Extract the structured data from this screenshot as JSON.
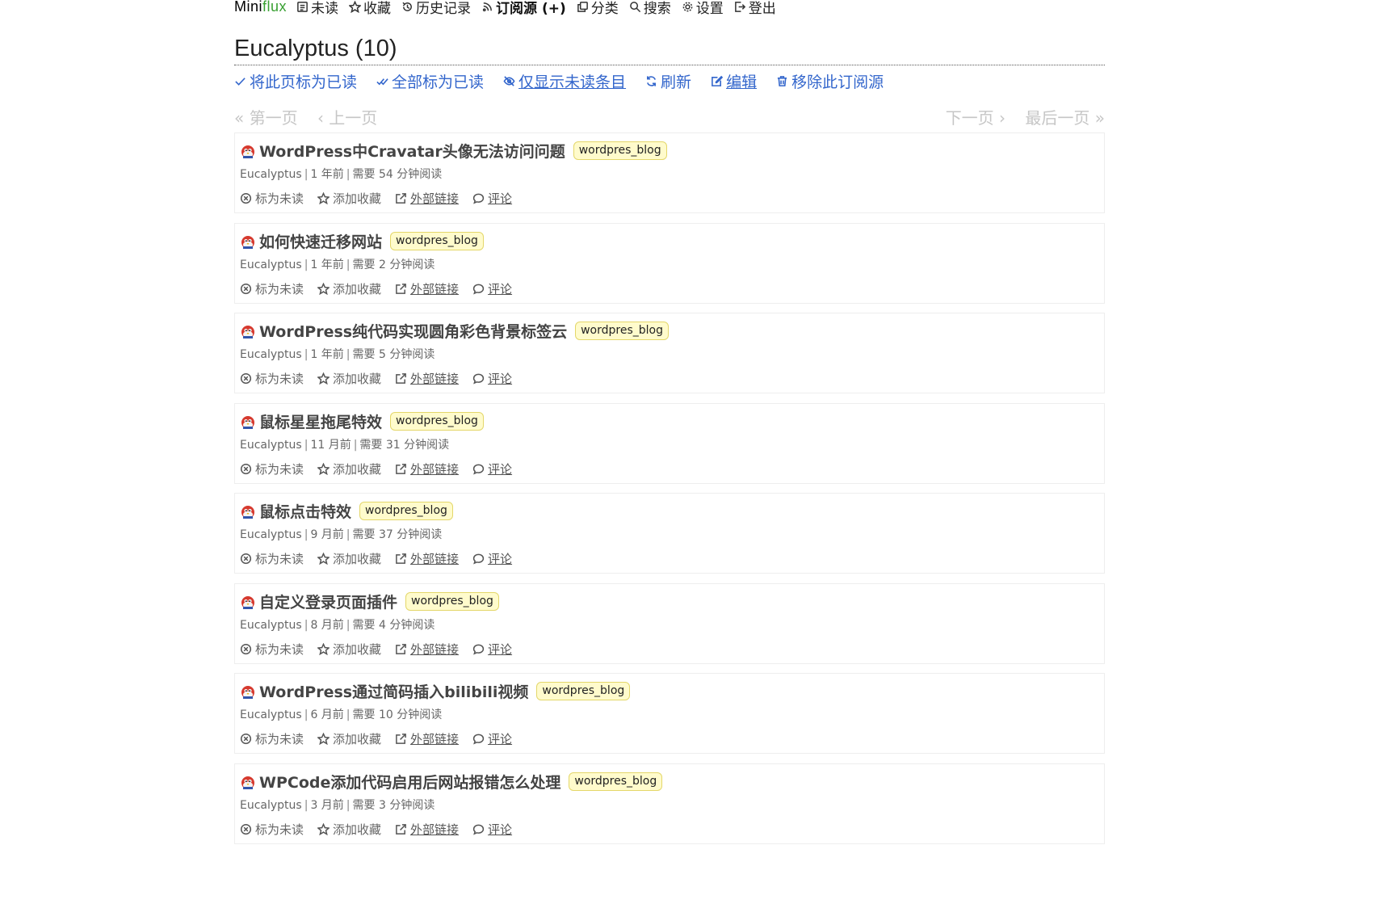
{
  "nav": {
    "logo_main": "Mini",
    "logo_accent": "flux",
    "items": [
      {
        "label": "未读",
        "icon": "unread-icon"
      },
      {
        "label": "收藏",
        "icon": "star-icon"
      },
      {
        "label": "历史记录",
        "icon": "history-icon"
      },
      {
        "label": "订阅源 (+)",
        "icon": "rss-icon",
        "active": true
      },
      {
        "label": "分类",
        "icon": "category-icon"
      },
      {
        "label": "搜索",
        "icon": "search-icon"
      },
      {
        "label": "设置",
        "icon": "gear-icon"
      },
      {
        "label": "登出",
        "icon": "logout-icon"
      }
    ]
  },
  "page": {
    "title": "Eucalyptus (10)"
  },
  "actions": {
    "mark_page_read": "将此页标为已读",
    "mark_all_read": "全部标为已读",
    "show_unread_only": "仅显示未读条目",
    "refresh": "刷新",
    "edit": "编辑",
    "remove_feed": "移除此订阅源"
  },
  "pagination": {
    "first": "« 第一页",
    "prev": "‹ 上一页",
    "next": "下一页 ›",
    "last": "最后一页 »"
  },
  "entry_actions": {
    "mark_unread": "标为未读",
    "star": "添加收藏",
    "external_link": "外部链接",
    "comments": "评论"
  },
  "entries": [
    {
      "title": "WordPress中Cravatar头像无法访问问题",
      "tag": "wordpres_blog",
      "feed": "Eucalyptus",
      "age": "1 年前",
      "reading": "需要 54 分钟阅读"
    },
    {
      "title": "如何快速迁移网站",
      "tag": "wordpres_blog",
      "feed": "Eucalyptus",
      "age": "1 年前",
      "reading": "需要 2 分钟阅读"
    },
    {
      "title": "WordPress纯代码实现圆角彩色背景标签云",
      "tag": "wordpres_blog",
      "feed": "Eucalyptus",
      "age": "1 年前",
      "reading": "需要 5 分钟阅读"
    },
    {
      "title": "鼠标星星拖尾特效",
      "tag": "wordpres_blog",
      "feed": "Eucalyptus",
      "age": "11 月前",
      "reading": "需要 31 分钟阅读"
    },
    {
      "title": "鼠标点击特效",
      "tag": "wordpres_blog",
      "feed": "Eucalyptus",
      "age": "9 月前",
      "reading": "需要 37 分钟阅读"
    },
    {
      "title": "自定义登录页面插件",
      "tag": "wordpres_blog",
      "feed": "Eucalyptus",
      "age": "8 月前",
      "reading": "需要 4 分钟阅读"
    },
    {
      "title": "WordPress通过简码插入bilibili视频",
      "tag": "wordpres_blog",
      "feed": "Eucalyptus",
      "age": "6 月前",
      "reading": "需要 10 分钟阅读"
    },
    {
      "title": "WPCode添加代码启用后网站报错怎么处理",
      "tag": "wordpres_blog",
      "feed": "Eucalyptus",
      "age": "3 月前",
      "reading": "需要 3 分钟阅读"
    }
  ]
}
